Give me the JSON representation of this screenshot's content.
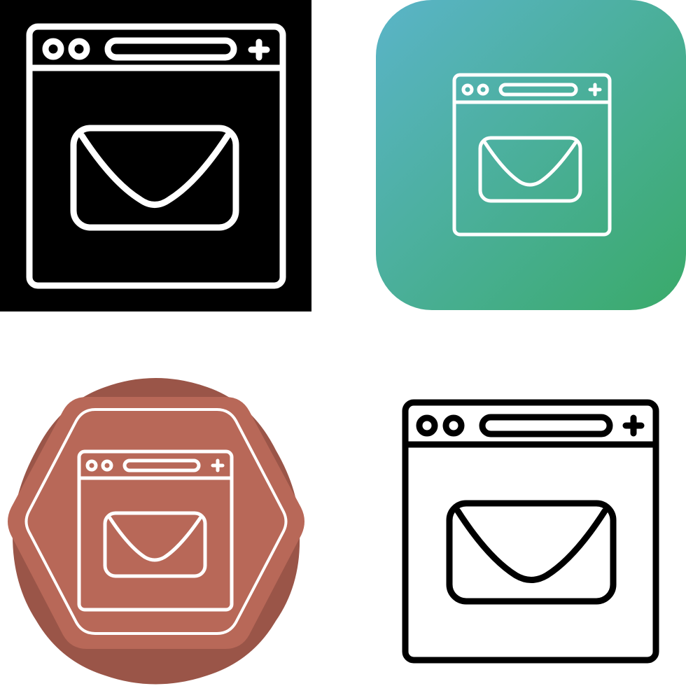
{
  "icon_set": {
    "subject": "browser-mail-icon",
    "variants": [
      {
        "style": "glyph",
        "background": "#000000",
        "stroke": "#ffffff"
      },
      {
        "style": "gradient-rounded",
        "gradient_from": "#5ab4c8",
        "gradient_to": "#3aaa6a",
        "stroke": "#ffffff"
      },
      {
        "style": "badge",
        "badge_fill": "#b86858",
        "badge_shadow": "#9a5548",
        "stroke": "#ffffff"
      },
      {
        "style": "line",
        "background": "#ffffff",
        "stroke": "#000000"
      }
    ]
  }
}
